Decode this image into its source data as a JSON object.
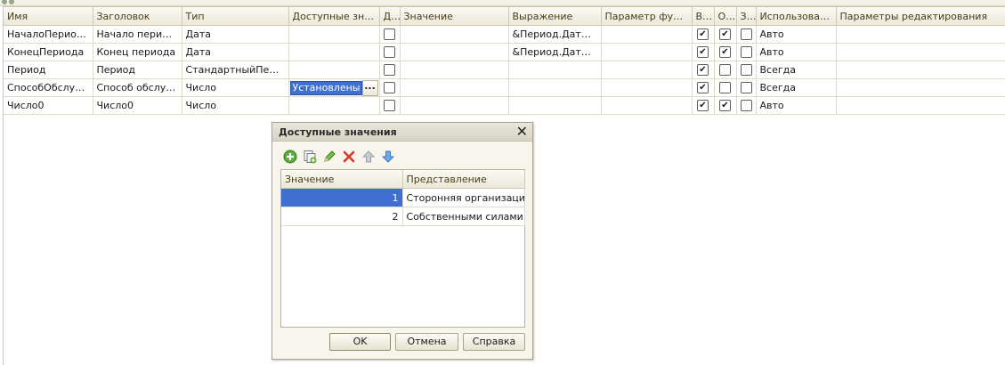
{
  "grid": {
    "columns": [
      "Имя",
      "Заголовок",
      "Тип",
      "Доступные зна...",
      "Д...",
      "Значение",
      "Выражение",
      "Параметр функ...",
      "В...",
      "О...",
      "З...",
      "Использование",
      "Параметры редактирования"
    ],
    "rows": [
      {
        "name": "НачалоПериода",
        "title": "Начало периода",
        "type": "Дата",
        "avail": "",
        "use_d": false,
        "value": "",
        "expr": "&Период.ДатаНа...",
        "param": "",
        "c1": true,
        "c2": true,
        "c3": false,
        "usage": "Авто",
        "edit": ""
      },
      {
        "name": "КонецПериода",
        "title": "Конец периода",
        "type": "Дата",
        "avail": "",
        "use_d": false,
        "value": "",
        "expr": "&Период.ДатаОк...",
        "param": "",
        "c1": true,
        "c2": true,
        "c3": false,
        "usage": "Авто",
        "edit": ""
      },
      {
        "name": "Период",
        "title": "Период",
        "type": "СтандартныйПериод",
        "avail": "",
        "use_d": false,
        "value": "",
        "expr": "",
        "param": "",
        "c1": true,
        "c2": false,
        "c3": false,
        "usage": "Всегда",
        "edit": ""
      },
      {
        "name": "СпособОбслуж...",
        "title": "Способ обслуж...",
        "type": "Число",
        "avail": "Установлены",
        "use_d": false,
        "value": "",
        "expr": "",
        "param": "",
        "c1": true,
        "c2": false,
        "c3": false,
        "usage": "Всегда",
        "edit": ""
      },
      {
        "name": "Число0",
        "title": "Число0",
        "type": "Число",
        "avail": "",
        "use_d": false,
        "value": "",
        "expr": "",
        "param": "",
        "c1": true,
        "c2": true,
        "c3": false,
        "usage": "Авто",
        "edit": ""
      }
    ],
    "editing_button": "..."
  },
  "dialog": {
    "title": "Доступные значения",
    "close_glyph": "✕",
    "columns": [
      "Значение",
      "Представление"
    ],
    "rows": [
      {
        "value": "1",
        "presentation": "Сторонняя организация"
      },
      {
        "value": "2",
        "presentation": "Собственными силами"
      }
    ],
    "buttons": {
      "ok": "OK",
      "cancel": "Отмена",
      "help": "Справка"
    },
    "toolbar": [
      "add-icon",
      "copy-icon",
      "edit-icon",
      "delete-icon",
      "move-up-icon",
      "move-down-icon"
    ]
  },
  "colors": {
    "selection": "#3f6fd1",
    "header": "#ebe8d8"
  }
}
